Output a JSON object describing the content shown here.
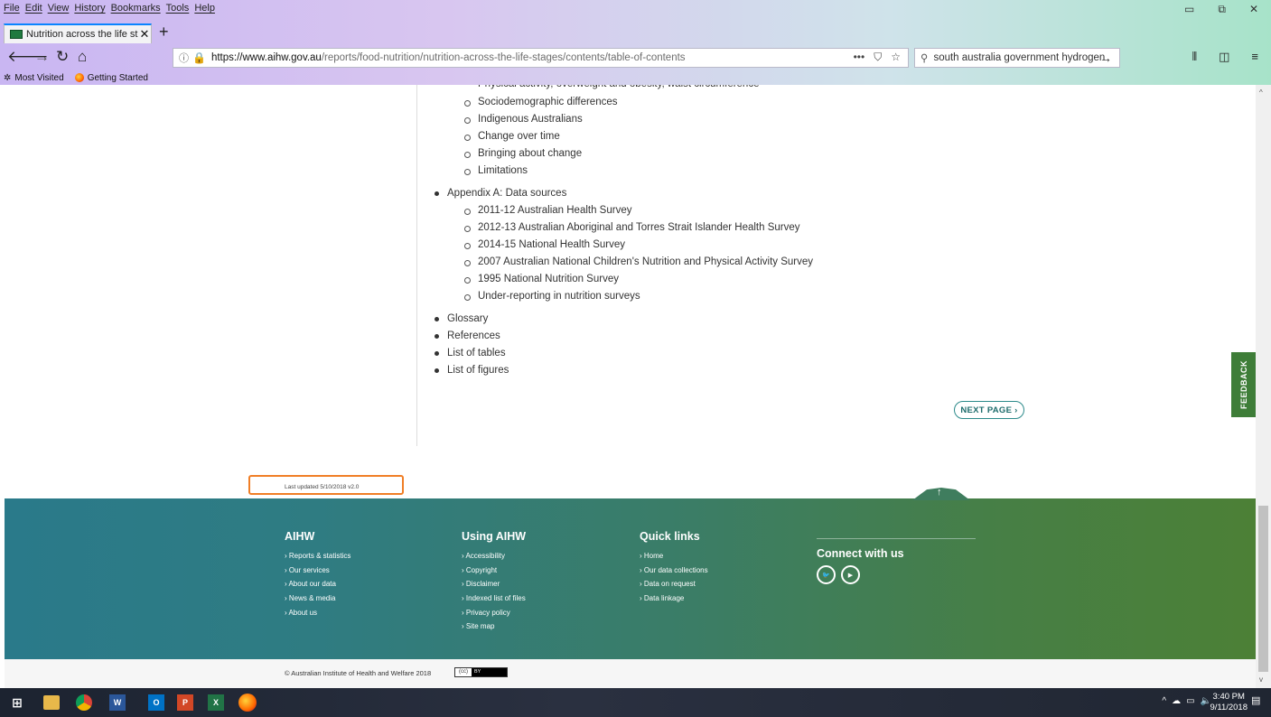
{
  "menu": [
    "File",
    "Edit",
    "View",
    "History",
    "Bookmarks",
    "Tools",
    "Help"
  ],
  "tab": {
    "title": "Nutrition across the life stages"
  },
  "address": {
    "host": "https://www.aihw.gov.au",
    "path": "/reports/food-nutrition/nutrition-across-the-life-stages/contents/table-of-contents"
  },
  "search": {
    "value": "south australia government hydrogen"
  },
  "bookmarks": [
    "Most Visited",
    "Getting Started"
  ],
  "toc": {
    "cutoff_item": "Physical activity, overweight and obesity, waist circumference",
    "section1_sub": [
      "Sociodemographic differences",
      "Indigenous Australians",
      "Change over time",
      "Bringing about change",
      "Limitations"
    ],
    "appendix": {
      "label": "Appendix A: Data sources",
      "sub": [
        "2011-12 Australian Health Survey",
        "2012-13 Australian Aboriginal and Torres Strait Islander Health Survey",
        "2014-15 National Health Survey",
        "2007 Australian National Children's Nutrition and Physical Activity Survey",
        "1995 National Nutrition Survey",
        "Under-reporting in nutrition surveys"
      ]
    },
    "other": [
      "Glossary",
      "References",
      "List of tables",
      "List of figures"
    ]
  },
  "next_page": "NEXT PAGE ›",
  "feedback": "FEEDBACK",
  "last_updated": "Last updated 5/10/2018 v2.0",
  "footer": {
    "aihw": {
      "title": "AIHW",
      "links": [
        "Reports & statistics",
        "Our services",
        "About our data",
        "News & media",
        "About us"
      ]
    },
    "using": {
      "title": "Using AIHW",
      "links": [
        "Accessibility",
        "Copyright",
        "Disclaimer",
        "Indexed list of files",
        "Privacy policy",
        "Site map"
      ]
    },
    "quick": {
      "title": "Quick links",
      "links": [
        "Home",
        "Our data collections",
        "Data on request",
        "Data linkage"
      ]
    },
    "connect": {
      "title": "Connect with us"
    }
  },
  "copyright": "© Australian Institute of Health and Welfare 2018",
  "cc_label": "BY",
  "clock": {
    "time": "3:40 PM",
    "date": "9/11/2018"
  }
}
